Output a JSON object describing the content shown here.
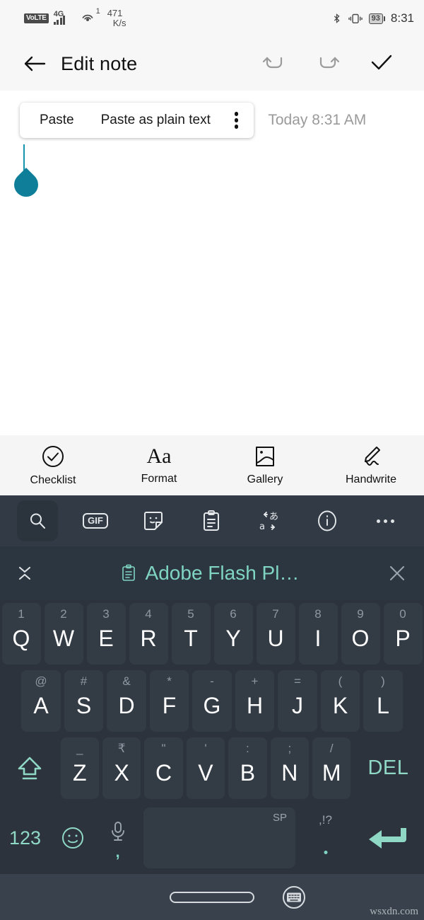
{
  "statusbar": {
    "volte": "VoLTE",
    "network_type": "4G",
    "hotspot_count": "1",
    "net_speed_value": "471",
    "net_speed_unit": "K/s",
    "bluetooth_icon": "bluetooth-icon",
    "vibrate_icon": "vibrate-icon",
    "battery_level": "93",
    "clock": "8:31"
  },
  "appbar": {
    "back_icon": "back-arrow-icon",
    "title": "Edit note",
    "undo_icon": "undo-icon",
    "redo_icon": "redo-icon",
    "done_icon": "check-icon"
  },
  "note": {
    "paste_label": "Paste",
    "paste_plain_label": "Paste as plain text",
    "overflow_icon": "more-vertical-icon",
    "timestamp": "Today 8:31 AM",
    "body_text": "",
    "cursor_handle_icon": "text-cursor-handle-icon",
    "cursor_color": "#0f7e99"
  },
  "format_toolbar": {
    "items": [
      {
        "label": "Checklist",
        "icon": "check-circle-icon"
      },
      {
        "label": "Format",
        "icon": "aa-text-icon",
        "glyph": "Aa"
      },
      {
        "label": "Gallery",
        "icon": "image-icon"
      },
      {
        "label": "Handwrite",
        "icon": "pen-scribble-icon"
      }
    ]
  },
  "keyboard_toolbar": {
    "items": [
      {
        "icon": "search-icon",
        "selected": true
      },
      {
        "icon": "gif-icon",
        "label": "GIF",
        "selected": false
      },
      {
        "icon": "sticker-icon",
        "selected": false
      },
      {
        "icon": "clipboard-icon",
        "selected": false
      },
      {
        "icon": "translate-icon",
        "selected": false
      },
      {
        "icon": "info-icon",
        "selected": false
      },
      {
        "icon": "more-horizontal-icon",
        "selected": false
      }
    ]
  },
  "clipboard_bar": {
    "collapse_icon": "collapse-chevrons-icon",
    "clip_icon": "clipboard-small-icon",
    "clip_text": "Adobe Flash Pl…",
    "close_icon": "close-icon",
    "accent_color": "#7fd4c2"
  },
  "keyboard": {
    "accent_color": "#8fd8c6",
    "row1": [
      {
        "main": "Q",
        "alt": "1"
      },
      {
        "main": "W",
        "alt": "2"
      },
      {
        "main": "E",
        "alt": "3"
      },
      {
        "main": "R",
        "alt": "4"
      },
      {
        "main": "T",
        "alt": "5"
      },
      {
        "main": "Y",
        "alt": "6"
      },
      {
        "main": "U",
        "alt": "7"
      },
      {
        "main": "I",
        "alt": "8"
      },
      {
        "main": "O",
        "alt": "9"
      },
      {
        "main": "P",
        "alt": "0"
      }
    ],
    "row2": [
      {
        "main": "A",
        "alt": "@"
      },
      {
        "main": "S",
        "alt": "#"
      },
      {
        "main": "D",
        "alt": "&"
      },
      {
        "main": "F",
        "alt": "*"
      },
      {
        "main": "G",
        "alt": "-"
      },
      {
        "main": "H",
        "alt": "+"
      },
      {
        "main": "J",
        "alt": "="
      },
      {
        "main": "K",
        "alt": "("
      },
      {
        "main": "L",
        "alt": ")"
      }
    ],
    "row3": {
      "shift_icon": "shift-icon",
      "keys": [
        {
          "main": "Z",
          "alt": "_"
        },
        {
          "main": "X",
          "alt": "₹"
        },
        {
          "main": "C",
          "alt": "\""
        },
        {
          "main": "V",
          "alt": "'"
        },
        {
          "main": "B",
          "alt": ":"
        },
        {
          "main": "N",
          "alt": ";"
        },
        {
          "main": "M",
          "alt": "/"
        }
      ],
      "delete_label": "DEL"
    },
    "row4": {
      "numbers_label": "123",
      "emoji_icon": "emoji-smiley-icon",
      "mic_icon": "microphone-icon",
      "comma_label": ",",
      "space_tag": "SP",
      "punctuation_top": ",!?",
      "punctuation_bottom": ".",
      "enter_icon": "enter-arrow-icon"
    }
  },
  "navbar": {
    "home_pill_icon": "home-pill-icon",
    "keyboard_icon": "hide-keyboard-icon"
  },
  "watermark": {
    "text": "wsxdn.com"
  }
}
